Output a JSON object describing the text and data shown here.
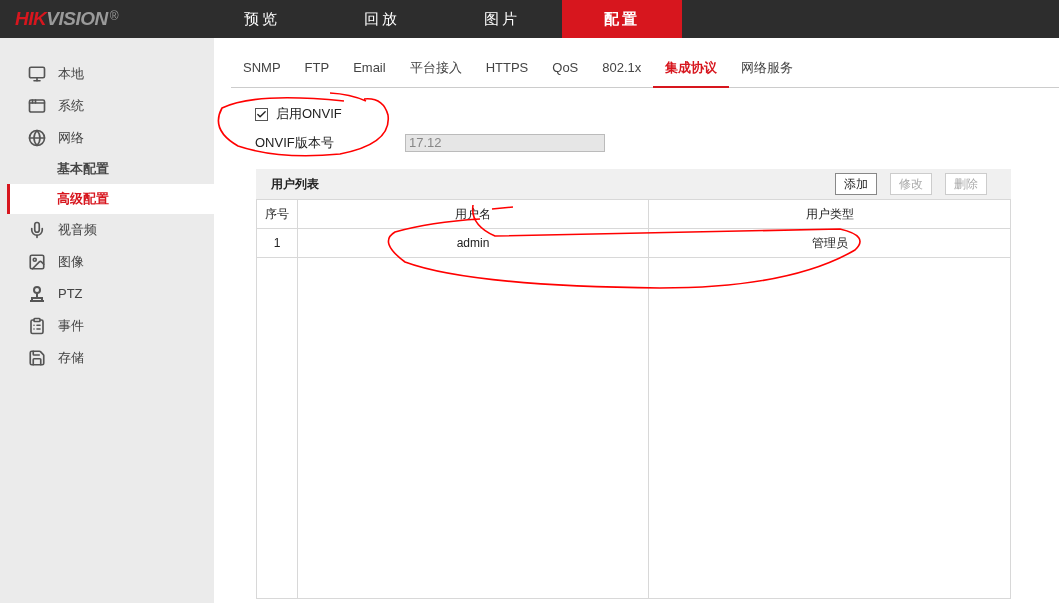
{
  "logo": {
    "brand_part": "HIK",
    "rest": "VISION",
    "mark": "®"
  },
  "nav": [
    {
      "label": "预览",
      "selected": false
    },
    {
      "label": "回放",
      "selected": false
    },
    {
      "label": "图片",
      "selected": false
    },
    {
      "label": "配置",
      "selected": true
    }
  ],
  "sidebar": {
    "items": [
      {
        "label": "本地",
        "kind": "local",
        "selected": false
      },
      {
        "label": "系统",
        "kind": "system",
        "selected": false
      },
      {
        "label": "网络",
        "kind": "network",
        "selected": false,
        "children": [
          {
            "label": "基本配置",
            "selected": false
          },
          {
            "label": "高级配置",
            "selected": true
          }
        ]
      },
      {
        "label": "视音频",
        "kind": "media",
        "selected": false
      },
      {
        "label": "图像",
        "kind": "picture",
        "selected": false
      },
      {
        "label": "PTZ",
        "kind": "ptz",
        "selected": false
      },
      {
        "label": "事件",
        "kind": "event",
        "selected": false
      },
      {
        "label": "存储",
        "kind": "storage",
        "selected": false
      }
    ]
  },
  "tabs": [
    {
      "label": "SNMP",
      "selected": false
    },
    {
      "label": "FTP",
      "selected": false
    },
    {
      "label": "Email",
      "selected": false
    },
    {
      "label": "平台接入",
      "selected": false
    },
    {
      "label": "HTTPS",
      "selected": false
    },
    {
      "label": "QoS",
      "selected": false
    },
    {
      "label": "802.1x",
      "selected": false
    },
    {
      "label": "集成协议",
      "selected": true
    },
    {
      "label": "网络服务",
      "selected": false
    }
  ],
  "onvif": {
    "enable_label": "启用ONVIF",
    "checked": true,
    "version_label": "ONVIF版本号",
    "version_value": "17.12",
    "version_disabled": true
  },
  "user_list": {
    "title": "用户列表",
    "buttons": [
      {
        "label": "添加",
        "disabled": false
      },
      {
        "label": "修改",
        "disabled": true
      },
      {
        "label": "删除",
        "disabled": true
      }
    ],
    "columns": [
      "序号",
      "用户名",
      "用户类型"
    ],
    "rows": [
      [
        "1",
        "admin",
        "管理员"
      ]
    ]
  }
}
